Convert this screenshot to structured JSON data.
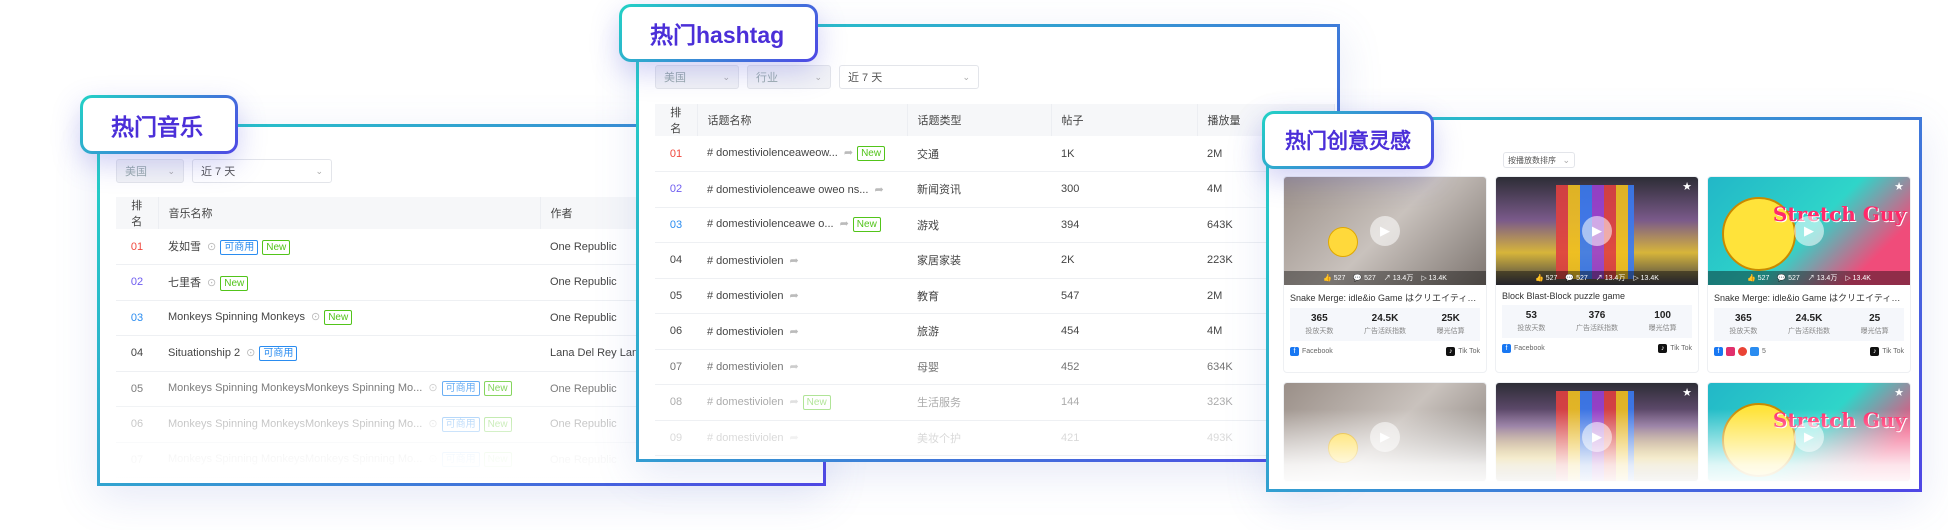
{
  "music": {
    "title": "热门音乐",
    "filters": {
      "region": "美国",
      "period": "近 7 天"
    },
    "columns": [
      "排名",
      "音乐名称",
      "作者"
    ],
    "rows": [
      {
        "rank": "01",
        "name": "发如雪",
        "badges": [
          "可商用",
          "New"
        ],
        "author": "One Republic"
      },
      {
        "rank": "02",
        "name": "七里香",
        "badges": [
          "New"
        ],
        "author": "One Republic"
      },
      {
        "rank": "03",
        "name": "Monkeys Spinning Monkeys",
        "badges": [
          "New"
        ],
        "author": "One Republic"
      },
      {
        "rank": "04",
        "name": "Situationship 2",
        "badges": [
          "可商用"
        ],
        "author": "Lana Del Rey Lan"
      },
      {
        "rank": "05",
        "name": "Monkeys Spinning MonkeysMonkeys Spinning Mo...",
        "badges": [
          "可商用",
          "New"
        ],
        "author": "One Republic"
      },
      {
        "rank": "06",
        "name": "Monkeys Spinning MonkeysMonkeys Spinning Mo...",
        "badges": [
          "可商用",
          "New"
        ],
        "author": "One Republic"
      },
      {
        "rank": "07",
        "name": "Monkeys Spinning MonkeysMonkeys Spinning Mo...",
        "badges": [
          "可商用",
          "New"
        ],
        "author": "One Republic"
      }
    ]
  },
  "hashtag": {
    "title": "热门hashtag",
    "filters": {
      "region": "美国",
      "industry": "行业",
      "period": "近 7 天"
    },
    "columns": [
      "排名",
      "话题名称",
      "话题类型",
      "帖子",
      "播放量"
    ],
    "rows": [
      {
        "rank": "01",
        "name": "# domestiviolenceaweow...",
        "badge": "New",
        "type": "交通",
        "posts": "1K",
        "views": "2M"
      },
      {
        "rank": "02",
        "name": "# domestiviolenceawe oweo ns...",
        "badge": "",
        "type": "新闻资讯",
        "posts": "300",
        "views": "4M"
      },
      {
        "rank": "03",
        "name": "# domestiviolenceawe o...",
        "badge": "New",
        "type": "游戏",
        "posts": "394",
        "views": "643K"
      },
      {
        "rank": "04",
        "name": "# domestiviolen",
        "badge": "",
        "type": "家居家装",
        "posts": "2K",
        "views": "223K"
      },
      {
        "rank": "05",
        "name": "# domestiviolen",
        "badge": "",
        "type": "教育",
        "posts": "547",
        "views": "2M"
      },
      {
        "rank": "06",
        "name": "# domestiviolen",
        "badge": "",
        "type": "旅游",
        "posts": "454",
        "views": "4M"
      },
      {
        "rank": "07",
        "name": "# domestiviolen",
        "badge": "",
        "type": "母婴",
        "posts": "452",
        "views": "634K"
      },
      {
        "rank": "08",
        "name": "# domestiviolen",
        "badge": "New",
        "type": "生活服务",
        "posts": "144",
        "views": "323K"
      },
      {
        "rank": "09",
        "name": "# domestiviolen",
        "badge": "",
        "type": "美妆个护",
        "posts": "421",
        "views": "493K"
      }
    ]
  },
  "creative": {
    "title": "热门创意灵感",
    "sort_label": "按播放数排序",
    "cards": [
      {
        "title": "Snake Merge: idle&io Game はクリエイティブ...",
        "days": "365",
        "days_label": "投放天数",
        "index": "24.5K",
        "index_label": "广告活跃指数",
        "exposure": "25K",
        "exposure_label": "曝光估算",
        "left_platform": "Facebook",
        "right_platform": "Tik Tok",
        "strip": [
          "527",
          "527",
          "13.4万",
          "13.4K"
        ]
      },
      {
        "title": "Block Blast-Block puzzle game",
        "days": "53",
        "days_label": "投放天数",
        "index": "376",
        "index_label": "广告活跃指数",
        "exposure": "100",
        "exposure_label": "曝光估算",
        "left_platform": "Facebook",
        "right_platform": "Tik Tok",
        "strip": [
          "527",
          "527",
          "13.4万",
          "13.4K"
        ]
      },
      {
        "title": "Snake Merge: idle&io Game はクリエイティブ...",
        "days": "365",
        "days_label": "投放天数",
        "index": "24.5K",
        "index_label": "广告活跃指数",
        "exposure": "25",
        "exposure_label": "曝光估算",
        "left_platform": "5",
        "right_platform": "Tik Tok",
        "strip": [
          "527",
          "527",
          "13.4万",
          "13.4K"
        ]
      }
    ],
    "stretch_text": "Stretch Guy"
  }
}
